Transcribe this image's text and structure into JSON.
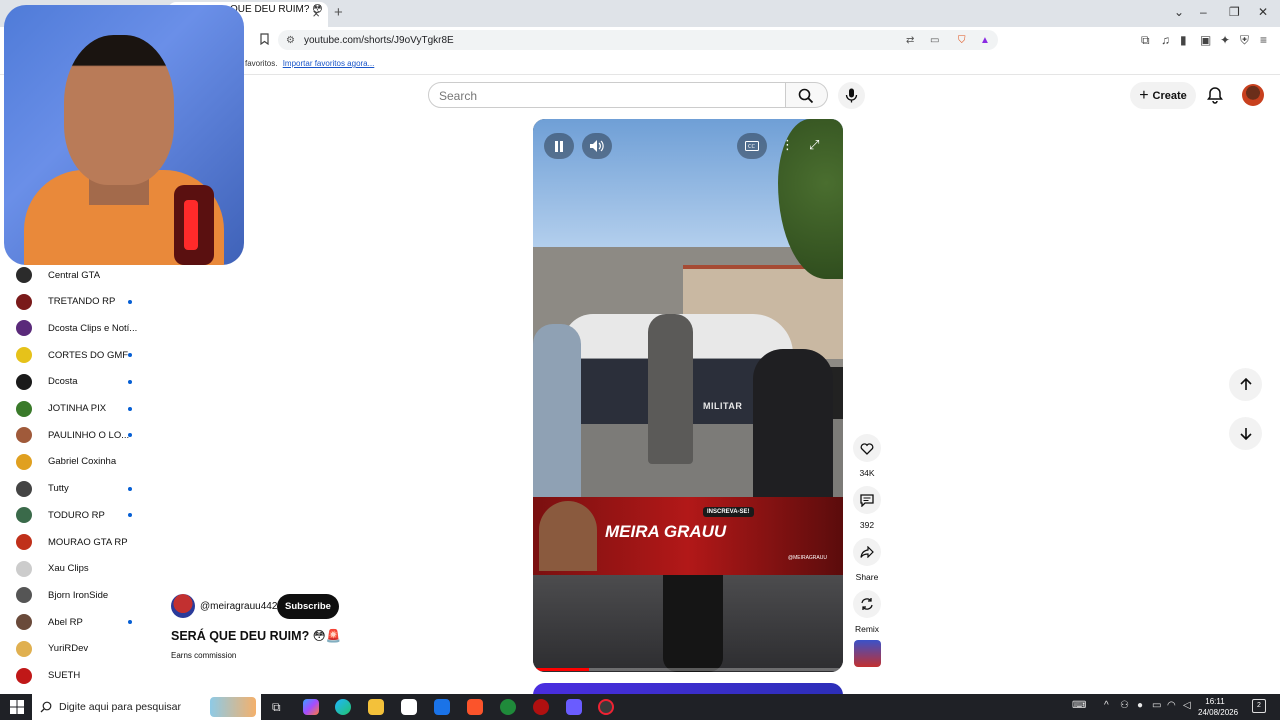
{
  "browser": {
    "tab_title": "QUE DEU RUIM? 😳🚨",
    "url": "youtube.com/shorts/J9oVyTgkr8E",
    "bookmark_text": "favoritos.",
    "bookmark_link": "Importar favoritos agora..."
  },
  "youtube": {
    "search_placeholder": "Search",
    "create_label": "Create"
  },
  "sidebar": {
    "items": [
      {
        "label": "Central GTA",
        "dot": false,
        "color": "#2b2b2b"
      },
      {
        "label": "TRETANDO RP",
        "dot": true,
        "color": "#7a1a1a"
      },
      {
        "label": "Dcosta Clips e Notí...",
        "dot": false,
        "color": "#5a2a7a"
      },
      {
        "label": "CORTES DO GMF",
        "dot": true,
        "color": "#e6c21a"
      },
      {
        "label": "Dcosta",
        "dot": true,
        "color": "#1a1a1a"
      },
      {
        "label": "JOTINHA PIX",
        "dot": true,
        "color": "#3a7a2a"
      },
      {
        "label": "PAULINHO O LO...",
        "dot": true,
        "color": "#a05a3a"
      },
      {
        "label": "Gabriel Coxinha",
        "dot": false,
        "color": "#e0a020"
      },
      {
        "label": "Tutty",
        "dot": true,
        "color": "#444444"
      },
      {
        "label": "TODURO RP",
        "dot": true,
        "color": "#3a6a4a"
      },
      {
        "label": "MOURAO GTA RP",
        "dot": false,
        "color": "#c0301a"
      },
      {
        "label": "Xau Clips",
        "dot": false,
        "color": "#cccccc"
      },
      {
        "label": "Bjorn IronSide",
        "dot": false,
        "color": "#555555"
      },
      {
        "label": "Abel RP",
        "dot": true,
        "color": "#6a4a3a"
      },
      {
        "label": "YuriRDev",
        "dot": false,
        "color": "#e0b050"
      },
      {
        "label": "SUETH",
        "dot": false,
        "color": "#c01818"
      }
    ]
  },
  "video": {
    "overlay_text": "MILITAR",
    "banner_title": "MEIRA GRAUU",
    "banner_subscribe": "INSCREVA-SE!",
    "banner_handle": "@MEIRAGRAUU",
    "progress": 0.18
  },
  "actions": {
    "likes": "34K",
    "comments": "392",
    "share": "Share",
    "remix": "Remix"
  },
  "channel": {
    "handle": "@meiragrauu442",
    "subscribe": "Subscribe",
    "title": "SERÁ QUE DEU RUIM? 😳🚨",
    "earns": "Earns commission"
  },
  "taskbar": {
    "search_placeholder": "Digite aqui para pesquisar",
    "time": "16:11",
    "date": "24/08/2026",
    "notifications": "2"
  }
}
